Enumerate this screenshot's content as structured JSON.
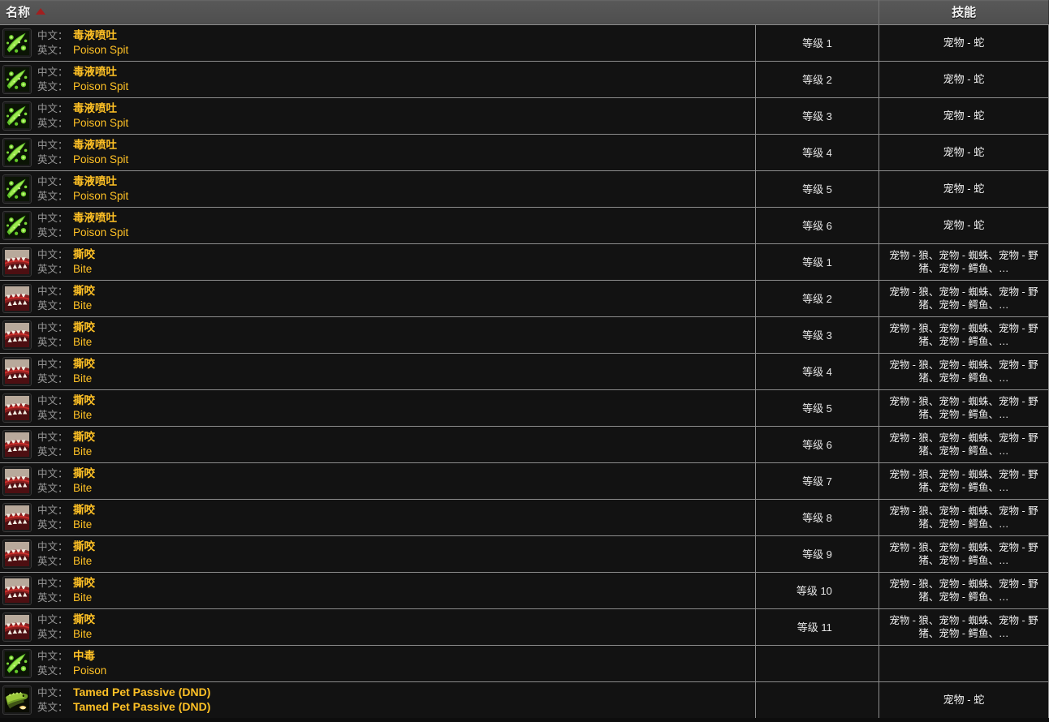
{
  "header": {
    "name_label": "名称",
    "skill_label": "技能",
    "sort_icon": "sort-asc-triangle-icon",
    "sort_direction": "ascending",
    "accent_color": "#a11f1f",
    "header_bg": "#555555"
  },
  "labels": {
    "cn": "中文：",
    "en": "英文："
  },
  "colors": {
    "value_gold": "#ffc125",
    "label_gray": "#9a9a9a",
    "row_bg": "#121212",
    "separator": "#8c8c8c"
  },
  "skill_text": {
    "snake": "宠物 - 蛇",
    "multi": "宠物 - 狼、宠物 - 蜘蛛、宠物 - 野猪、宠物 - 鳄鱼、…",
    "empty": ""
  },
  "rows": [
    {
      "icon": "poison-spit-icon",
      "cn": "毒液喷吐",
      "en": "Poison Spit",
      "rank": "等级 1",
      "skill": "宠物 - 蛇"
    },
    {
      "icon": "poison-spit-icon",
      "cn": "毒液喷吐",
      "en": "Poison Spit",
      "rank": "等级 2",
      "skill": "宠物 - 蛇"
    },
    {
      "icon": "poison-spit-icon",
      "cn": "毒液喷吐",
      "en": "Poison Spit",
      "rank": "等级 3",
      "skill": "宠物 - 蛇"
    },
    {
      "icon": "poison-spit-icon",
      "cn": "毒液喷吐",
      "en": "Poison Spit",
      "rank": "等级 4",
      "skill": "宠物 - 蛇"
    },
    {
      "icon": "poison-spit-icon",
      "cn": "毒液喷吐",
      "en": "Poison Spit",
      "rank": "等级 5",
      "skill": "宠物 - 蛇"
    },
    {
      "icon": "poison-spit-icon",
      "cn": "毒液喷吐",
      "en": "Poison Spit",
      "rank": "等级 6",
      "skill": "宠物 - 蛇"
    },
    {
      "icon": "bite-jaws-icon",
      "cn": "撕咬",
      "en": "Bite",
      "rank": "等级 1",
      "skill": "宠物 - 狼、宠物 - 蜘蛛、宠物 - 野猪、宠物 - 鳄鱼、…"
    },
    {
      "icon": "bite-jaws-icon",
      "cn": "撕咬",
      "en": "Bite",
      "rank": "等级 2",
      "skill": "宠物 - 狼、宠物 - 蜘蛛、宠物 - 野猪、宠物 - 鳄鱼、…"
    },
    {
      "icon": "bite-jaws-icon",
      "cn": "撕咬",
      "en": "Bite",
      "rank": "等级 3",
      "skill": "宠物 - 狼、宠物 - 蜘蛛、宠物 - 野猪、宠物 - 鳄鱼、…"
    },
    {
      "icon": "bite-jaws-icon",
      "cn": "撕咬",
      "en": "Bite",
      "rank": "等级 4",
      "skill": "宠物 - 狼、宠物 - 蜘蛛、宠物 - 野猪、宠物 - 鳄鱼、…"
    },
    {
      "icon": "bite-jaws-icon",
      "cn": "撕咬",
      "en": "Bite",
      "rank": "等级 5",
      "skill": "宠物 - 狼、宠物 - 蜘蛛、宠物 - 野猪、宠物 - 鳄鱼、…"
    },
    {
      "icon": "bite-jaws-icon",
      "cn": "撕咬",
      "en": "Bite",
      "rank": "等级 6",
      "skill": "宠物 - 狼、宠物 - 蜘蛛、宠物 - 野猪、宠物 - 鳄鱼、…"
    },
    {
      "icon": "bite-jaws-icon",
      "cn": "撕咬",
      "en": "Bite",
      "rank": "等级 7",
      "skill": "宠物 - 狼、宠物 - 蜘蛛、宠物 - 野猪、宠物 - 鳄鱼、…"
    },
    {
      "icon": "bite-jaws-icon",
      "cn": "撕咬",
      "en": "Bite",
      "rank": "等级 8",
      "skill": "宠物 - 狼、宠物 - 蜘蛛、宠物 - 野猪、宠物 - 鳄鱼、…"
    },
    {
      "icon": "bite-jaws-icon",
      "cn": "撕咬",
      "en": "Bite",
      "rank": "等级 9",
      "skill": "宠物 - 狼、宠物 - 蜘蛛、宠物 - 野猪、宠物 - 鳄鱼、…"
    },
    {
      "icon": "bite-jaws-icon",
      "cn": "撕咬",
      "en": "Bite",
      "rank": "等级 10",
      "skill": "宠物 - 狼、宠物 - 蜘蛛、宠物 - 野猪、宠物 - 鳄鱼、…"
    },
    {
      "icon": "bite-jaws-icon",
      "cn": "撕咬",
      "en": "Bite",
      "rank": "等级 11",
      "skill": "宠物 - 狼、宠物 - 蜘蛛、宠物 - 野猪、宠物 - 鳄鱼、…"
    },
    {
      "icon": "poison-spit-icon",
      "cn": "中毒",
      "en": "Poison",
      "rank": "",
      "skill": ""
    },
    {
      "icon": "tamed-pet-crocolisk-icon",
      "cn": "Tamed Pet Passive (DND)",
      "en": "Tamed Pet Passive (DND)",
      "rank": "",
      "skill": "宠物 - 蛇"
    }
  ]
}
